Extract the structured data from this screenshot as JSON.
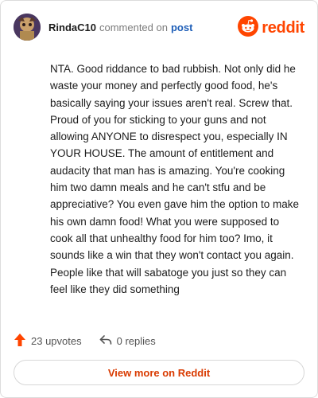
{
  "header": {
    "username": "RindaC10",
    "action_text": "commented on",
    "post_link": "post",
    "brand": "reddit",
    "avatar_icon": "user-avatar-icon",
    "brand_icon": "reddit-logo-icon",
    "brand_color": "#ff4500"
  },
  "comment": {
    "text": "NTA. Good riddance to bad rubbish. Not only did he waste your money and perfectly good food, he's basically saying your issues aren't real. Screw that. Proud of you for sticking to your guns and not allowing ANYONE to disrespect you, especially IN YOUR HOUSE. The amount of entitlement and audacity that man has is amazing. You're cooking him two damn meals and he can't stfu and be appreciative? You even gave him the option to make his own damn food! What you were supposed to cook all that unhealthy food for him too? Imo, it sounds like a win that they won't contact you again. People like that will sabatoge you just so they can feel like they did something"
  },
  "footer": {
    "upvotes": "23 upvotes",
    "replies": "0 replies",
    "upvote_icon": "upvote-arrow-icon",
    "reply_icon": "reply-arrow-icon",
    "upvote_color": "#ff4500"
  },
  "view_more": {
    "label": "View more on Reddit",
    "color": "#d93a00"
  }
}
